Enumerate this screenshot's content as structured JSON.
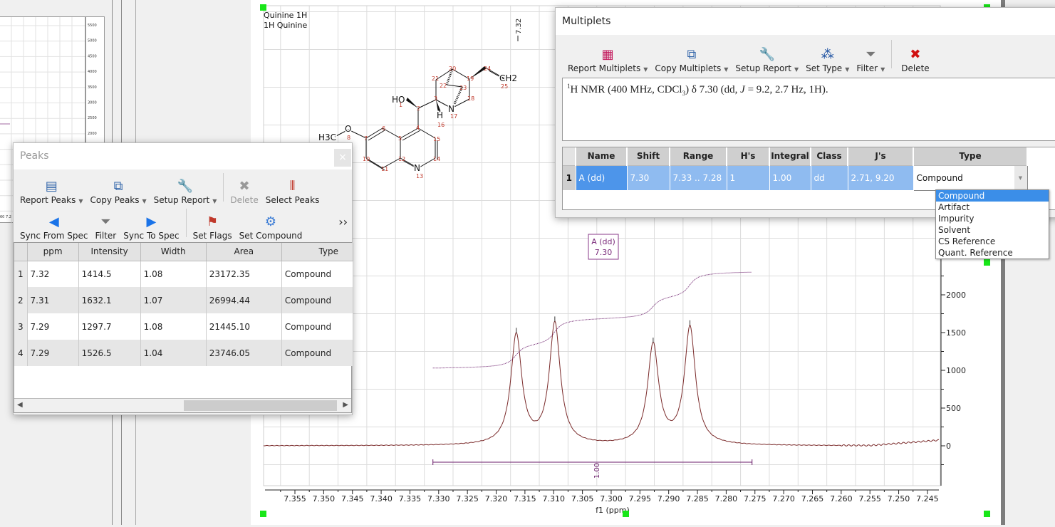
{
  "mini_spectrum": {
    "y_ticks": [
      "5500",
      "5000",
      "4500",
      "4000",
      "3500",
      "3000",
      "2500",
      "2000"
    ],
    "x_fragment": "60 7.2"
  },
  "spectrum": {
    "title_line1": "Quinine 1H",
    "title_line2": "1H Quinine",
    "peak_top_label": "7.32",
    "multiplet_label_name": "A (dd)",
    "multiplet_label_shift": "7.30",
    "integral_label": "1.00",
    "xlabel": "f1 (ppm)",
    "colors": {
      "spectrum": "#7a2a2a",
      "integral": "#6a1b6a",
      "handle": "#19e619"
    }
  },
  "chart_data": {
    "type": "line",
    "xlabel": "f1 (ppm)",
    "ylabel": "",
    "xlim": [
      7.359,
      7.243
    ],
    "ylim": [
      -500,
      2500
    ],
    "x_reversed": true,
    "grid": true,
    "x_ticks": [
      "7.355",
      "7.350",
      "7.345",
      "7.340",
      "7.335",
      "7.330",
      "7.325",
      "7.320",
      "7.315",
      "7.310",
      "7.305",
      "7.300",
      "7.295",
      "7.290",
      "7.285",
      "7.280",
      "7.275",
      "7.270",
      "7.265",
      "7.260",
      "7.255",
      "7.250",
      "7.245"
    ],
    "y_ticks": [
      "0",
      "500",
      "1000",
      "1500",
      "2000"
    ],
    "peaks": [
      {
        "ppm": 7.3165,
        "intensity": 1450
      },
      {
        "ppm": 7.3098,
        "intensity": 1600
      },
      {
        "ppm": 7.2927,
        "intensity": 1320
      },
      {
        "ppm": 7.2863,
        "intensity": 1550
      }
    ],
    "integral": {
      "from_ppm": 7.331,
      "to_ppm": 7.2755,
      "start_value": 1030,
      "end_value": 2300,
      "value": "1.00"
    }
  },
  "molecule": {
    "labels": [
      "HO",
      "H",
      "N",
      "N",
      "O",
      "H3C",
      "CH2"
    ],
    "numbers": [
      "1",
      "2",
      "3",
      "4",
      "5",
      "6",
      "7",
      "8",
      "10",
      "11",
      "12",
      "13",
      "14",
      "15",
      "16",
      "17",
      "18",
      "19",
      "20",
      "21",
      "22",
      "23",
      "24",
      "25"
    ]
  },
  "peaks_window": {
    "title": "Peaks",
    "close": "×",
    "toolbar1": [
      {
        "label": "Report Peaks",
        "icon": "report-icon",
        "dd": true
      },
      {
        "label": "Copy Peaks",
        "icon": "copy-icon",
        "dd": true
      },
      {
        "label": "Setup Report",
        "icon": "setup-icon",
        "dd": true
      },
      {
        "label": "Delete",
        "icon": "delete-icon",
        "disabled": true
      },
      {
        "label": "Select Peaks",
        "icon": "select-peaks-icon"
      }
    ],
    "toolbar2": [
      {
        "label": "Sync From Spec",
        "icon": "arrow-left-icon"
      },
      {
        "label": "Filter",
        "icon": "filter-icon"
      },
      {
        "label": "Sync To Spec",
        "icon": "arrow-right-icon"
      },
      {
        "label": "Set Flags",
        "icon": "flag-icon"
      },
      {
        "label": "Set Compound",
        "icon": "compound-icon"
      }
    ],
    "more": "››",
    "columns": [
      "ppm",
      "Intensity",
      "Width",
      "Area",
      "Type"
    ],
    "rows": [
      [
        "1",
        "7.32",
        "1414.5",
        "1.08",
        "23172.35",
        "Compound"
      ],
      [
        "2",
        "7.31",
        "1632.1",
        "1.07",
        "26994.44",
        "Compound"
      ],
      [
        "3",
        "7.29",
        "1297.7",
        "1.08",
        "21445.10",
        "Compound"
      ],
      [
        "4",
        "7.29",
        "1526.5",
        "1.04",
        "23746.05",
        "Compound"
      ]
    ]
  },
  "multiplets_window": {
    "title": "Multiplets",
    "toolbar": [
      {
        "label": "Report Multiplets",
        "icon": "report-multiplets-icon",
        "dd": true
      },
      {
        "label": "Copy Multiplets",
        "icon": "copy-icon",
        "dd": true
      },
      {
        "label": "Setup Report",
        "icon": "setup-icon",
        "dd": true
      },
      {
        "label": "Set Type",
        "icon": "set-type-icon",
        "dd": true
      },
      {
        "label": "Filter",
        "icon": "filter-icon",
        "dd": true
      },
      {
        "label": "Delete",
        "icon": "delete-icon"
      }
    ],
    "report_pre": "H NMR (400 MHz, CDCl",
    "report_sup": "1",
    "report_sub": "3",
    "report_mid": ") δ 7.30 (dd, ",
    "report_j": "J",
    "report_post": " = 9.2, 2.7 Hz, 1H).",
    "columns": [
      "Name",
      "Shift",
      "Range",
      "H's",
      "Integral",
      "Class",
      "J's",
      "Type"
    ],
    "row": [
      "1",
      "A (dd)",
      "7.30",
      "7.33 .. 7.28",
      "1",
      "1.00",
      "dd",
      "2.71, 9.20",
      "Compound"
    ],
    "type_options": [
      "Compound",
      "Artifact",
      "Impurity",
      "Solvent",
      "CS Reference",
      "Quant. Reference"
    ],
    "selected_option": "Compound"
  }
}
